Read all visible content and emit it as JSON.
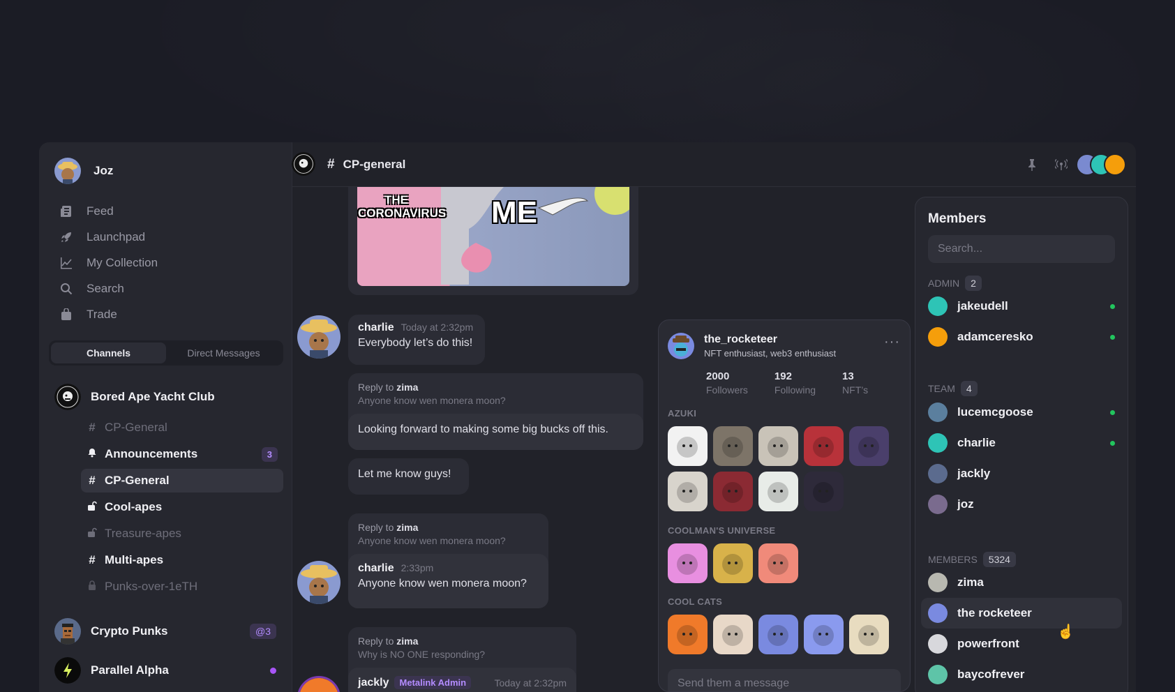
{
  "user": {
    "name": "Joz"
  },
  "nav": [
    {
      "label": "Feed",
      "icon": "feed-icon"
    },
    {
      "label": "Launchpad",
      "icon": "rocket-icon"
    },
    {
      "label": "My Collection",
      "icon": "chart-icon"
    },
    {
      "label": "Search",
      "icon": "search-icon"
    },
    {
      "label": "Trade",
      "icon": "bag-icon"
    }
  ],
  "tabs": {
    "channels": "Channels",
    "direct": "Direct Messages"
  },
  "servers": {
    "bayc": {
      "name": "Bored Ape Yacht Club"
    },
    "punks": {
      "name": "Crypto Punks",
      "badge": "@3"
    },
    "parallel": {
      "name": "Parallel Alpha"
    }
  },
  "channels": [
    {
      "symbol": "#",
      "label": "CP-General",
      "style": "dim"
    },
    {
      "symbol": "bell",
      "label": "Announcements",
      "style": "bright",
      "count": "3"
    },
    {
      "symbol": "#",
      "label": "CP-General",
      "style": "selected"
    },
    {
      "symbol": "unlock",
      "label": "Cool-apes",
      "style": "bright"
    },
    {
      "symbol": "unlock",
      "label": "Treasure-apes",
      "style": "dim"
    },
    {
      "symbol": "#",
      "label": "Multi-apes",
      "style": "bright"
    },
    {
      "symbol": "lock",
      "label": "Punks-over-1eTH",
      "style": "dim"
    }
  ],
  "header": {
    "channel": "CP-general",
    "hash": "#"
  },
  "meme": {
    "text_left": "THE CORONAVIRUS",
    "text_right": "ME"
  },
  "messages": {
    "m1": {
      "name": "charlie",
      "time": "Today at 2:32pm",
      "text": "Everybody let’s do this!"
    },
    "m2": {
      "reply_prefix": "Reply to",
      "reply_to": "zima",
      "quote": "Anyone know wen monera moon?",
      "text": "Looking forward to making some big bucks off this."
    },
    "m3": {
      "text": "Let me know guys!"
    },
    "m4": {
      "reply_prefix": "Reply to",
      "reply_to": "zima",
      "quote": "Anyone know wen monera moon?",
      "name": "charlie",
      "time": "2:33pm",
      "text": "Anyone know wen monera moon?"
    },
    "m5": {
      "reply_prefix": "Reply to",
      "reply_to": "zima",
      "quote": "Why is NO ONE responding?",
      "name": "jackly",
      "role": "Metalink Admin",
      "time": "Today at 2:32pm"
    }
  },
  "profile": {
    "name": "the_rocketeer",
    "bio": "NFT enthusiast, web3 enthusiast",
    "more": "···",
    "stats": [
      {
        "n": "2000",
        "l": "Followers"
      },
      {
        "n": "192",
        "l": "Following"
      },
      {
        "n": "13",
        "l": "NFT’s"
      }
    ],
    "collections": {
      "azuki": {
        "label": "AZUKI",
        "colors": [
          "#f2f2f2",
          "#7d7468",
          "#c9c3b8",
          "#b8323a",
          "#4a3f6b",
          "#d8d4cc",
          "#8b2a33",
          "#e8ece8",
          "#2e2a3a"
        ]
      },
      "coolman": {
        "label": "COOLMAN'S UNIVERSE",
        "colors": [
          "#e88fe0",
          "#d8b24a",
          "#f08a7a"
        ]
      },
      "coolcats": {
        "label": "COOL CATS",
        "colors": [
          "#f07a2a",
          "#e8d8c8",
          "#7a8ae0",
          "#8a9aee",
          "#e8dcc0"
        ]
      }
    },
    "input_placeholder": "Send them a message"
  },
  "members": {
    "title": "Members",
    "search_placeholder": "Search...",
    "groups": {
      "admin": {
        "label": "ADMIN",
        "count": "2"
      },
      "team": {
        "label": "TEAM",
        "count": "4"
      },
      "members": {
        "label": "MEMBERS",
        "count": "5324"
      }
    },
    "list": {
      "admin": [
        {
          "name": "jakeudell",
          "online": true,
          "color": "#2ec4b6"
        },
        {
          "name": "adamceresko",
          "online": true,
          "color": "#f59e0b"
        }
      ],
      "team": [
        {
          "name": "lucemcgoose",
          "online": true,
          "color": "#5b7f9e"
        },
        {
          "name": "charlie",
          "online": true,
          "color": "#2ec4b6"
        },
        {
          "name": "jackly",
          "online": false,
          "color": "#5b6b8e"
        },
        {
          "name": "joz",
          "online": false,
          "color": "#7a6b8e"
        }
      ],
      "members": [
        {
          "name": "zima",
          "online": false,
          "color": "#b8b8b0"
        },
        {
          "name": "the rocketeer",
          "online": false,
          "color": "#7a8ae0"
        },
        {
          "name": "powerfront",
          "online": false,
          "color": "#d8d8dc"
        },
        {
          "name": "baycofrever",
          "online": false,
          "color": "#5ec4a8"
        }
      ]
    }
  }
}
